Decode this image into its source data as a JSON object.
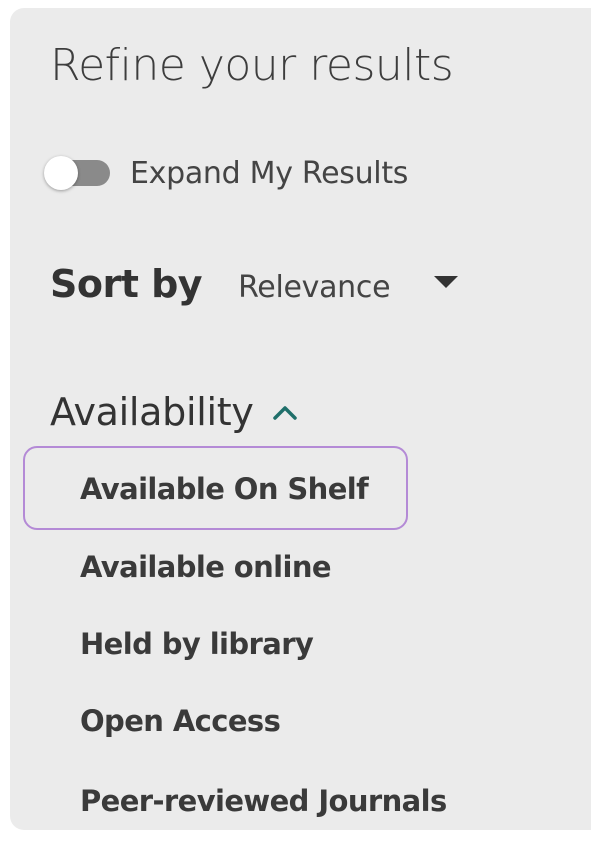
{
  "panel": {
    "title": "Refine your results"
  },
  "expand_toggle": {
    "label": "Expand My Results",
    "state": "off"
  },
  "sort": {
    "label": "Sort by",
    "selected": "Relevance"
  },
  "availability": {
    "title": "Availability",
    "items": [
      {
        "label": "Available On Shelf",
        "highlighted": true
      },
      {
        "label": "Available online"
      },
      {
        "label": "Held by library"
      },
      {
        "label": "Open Access"
      },
      {
        "label": "Peer-reviewed Journals"
      }
    ]
  },
  "colors": {
    "panel_bg": "#ebebeb",
    "highlight_border": "#b48ad6",
    "chevron": "#1f6f6a",
    "toggle_track": "#8a8a8a"
  },
  "icons": {
    "sort_dropdown": "caret-down-icon",
    "facet_toggle": "chevron-up-icon"
  }
}
